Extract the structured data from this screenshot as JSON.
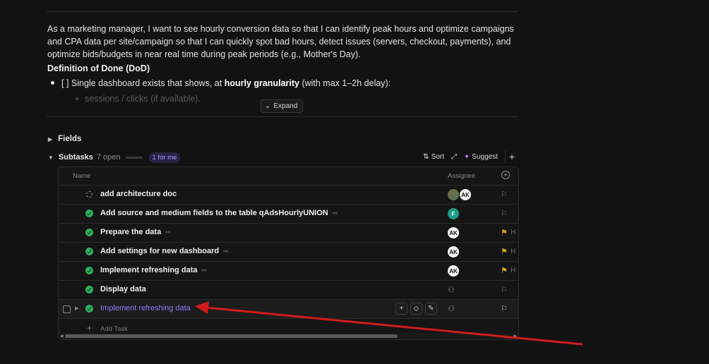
{
  "description": {
    "paragraph": "As a marketing manager, I want to see hourly conversion data so that I can identify peak hours and optimize campaigns and CPA data per site/campaign so that I can quickly spot bad hours, detect issues (servers, checkout, payments), and optimize bids/budgets in near real time during peak periods (e.g., Mother's Day).",
    "dod_heading": "Definition of Done (DoD)",
    "bullet_prefix": "[ ] Single dashboard exists that shows, at ",
    "bullet_bold": "hourly granularity",
    "bullet_suffix": " (with max 1–2h delay):",
    "sub_bullet": "sessions / clicks (if available).",
    "expand_label": "Expand"
  },
  "fields": {
    "label": "Fields"
  },
  "subtasks": {
    "title": "Subtasks",
    "open_count": "7 open",
    "for_me": "1 for me",
    "sort_label": "Sort",
    "suggest_label": "Suggest",
    "columns": {
      "name": "Name",
      "assignee": "Assignee"
    },
    "rows": [
      {
        "name": "add architecture doc",
        "status": "todo",
        "assignees": [
          "photo",
          "AK"
        ],
        "priority": "none",
        "has_desc": false
      },
      {
        "name": "Add source and medium fields to the table qAdsHourlyUNION",
        "status": "done",
        "assignees": [
          "F"
        ],
        "priority": "none",
        "has_desc": true
      },
      {
        "name": "Prepare the data",
        "status": "done",
        "assignees": [
          "AK"
        ],
        "priority": "high",
        "has_desc": true
      },
      {
        "name": "Add settings for new dashboard",
        "status": "done",
        "assignees": [
          "AK"
        ],
        "priority": "high",
        "has_desc": true
      },
      {
        "name": "Implement refreshing data",
        "status": "done",
        "assignees": [
          "AK"
        ],
        "priority": "high",
        "has_desc": true
      },
      {
        "name": "Display data",
        "status": "done",
        "assignees": [],
        "priority": "none",
        "has_desc": false
      },
      {
        "name": "Implement refreshing data",
        "status": "done",
        "assignees": [],
        "priority": "none",
        "has_desc": false,
        "hovered": true
      }
    ],
    "priority_letter": "H",
    "add_task_label": "Add Task"
  },
  "colors": {
    "background": "#121212",
    "accent": "#8e7dff",
    "done_status": "#2eae5f",
    "high_flag": "#d3a030",
    "annotation_arrow": "#d11a1a"
  }
}
